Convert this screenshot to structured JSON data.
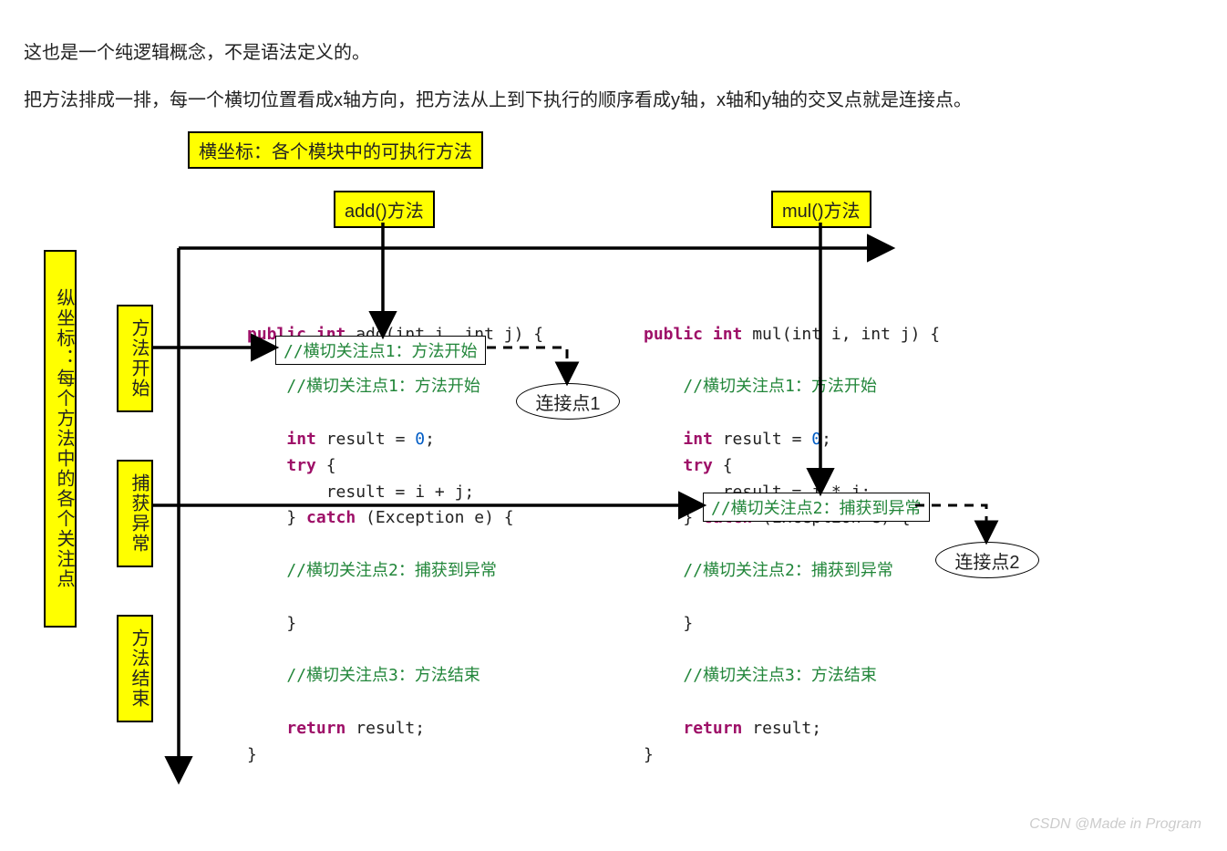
{
  "paragraphs": {
    "p1": "这也是一个纯逻辑概念，不是语法定义的。",
    "p2": "把方法排成一排，每一个横切位置看成x轴方向，把方法从上到下执行的顺序看成y轴，x轴和y轴的交叉点就是连接点。"
  },
  "labels": {
    "xaxis_title": "横坐标：各个模块中的可执行方法",
    "yaxis_title": "纵坐标：每个方法中的各个关注点",
    "row1": "方法开始",
    "row2": "捕获异常",
    "row3": "方法结束",
    "col1": "add()方法",
    "col2": "mul()方法",
    "joinpoint1": "连接点1",
    "joinpoint2": "连接点2",
    "focus1": "//横切关注点1：方法开始",
    "focus2": "//横切关注点2：捕获到异常"
  },
  "code": {
    "add": {
      "sig_pre": "public int ",
      "sig_name": "add",
      "sig_post": "(int i, int j) {",
      "c1": "//横切关注点1：方法开始",
      "l1": "int result = 0;",
      "l2": "try {",
      "l3": "    result = i + j;",
      "l4_pre": "} ",
      "l4_kw": "catch",
      "l4_post": " (Exception e) {",
      "c2": "    //横切关注点2：捕获到异常",
      "l5": "}",
      "c3": "//横切关注点3：方法结束",
      "l6_pre": "return",
      "l6_post": " result;",
      "l7": "}"
    },
    "mul": {
      "sig_pre": "public int ",
      "sig_name": "mul",
      "sig_post": "(int i, int j) {",
      "c1": "//横切关注点1：方法开始",
      "l1": "int result = 0;",
      "l2": "try {",
      "l3": "    result = i * j;",
      "l4_pre": "} ",
      "l4_kw": "catch",
      "l4_post": " (Exception e) {",
      "c2": "    //横切关注点2：捕获到异常",
      "l5": "}",
      "c3": "//横切关注点3：方法结束",
      "l6_pre": "return",
      "l6_post": " result;",
      "l7": "}"
    }
  },
  "watermark": "CSDN @Made in Program"
}
